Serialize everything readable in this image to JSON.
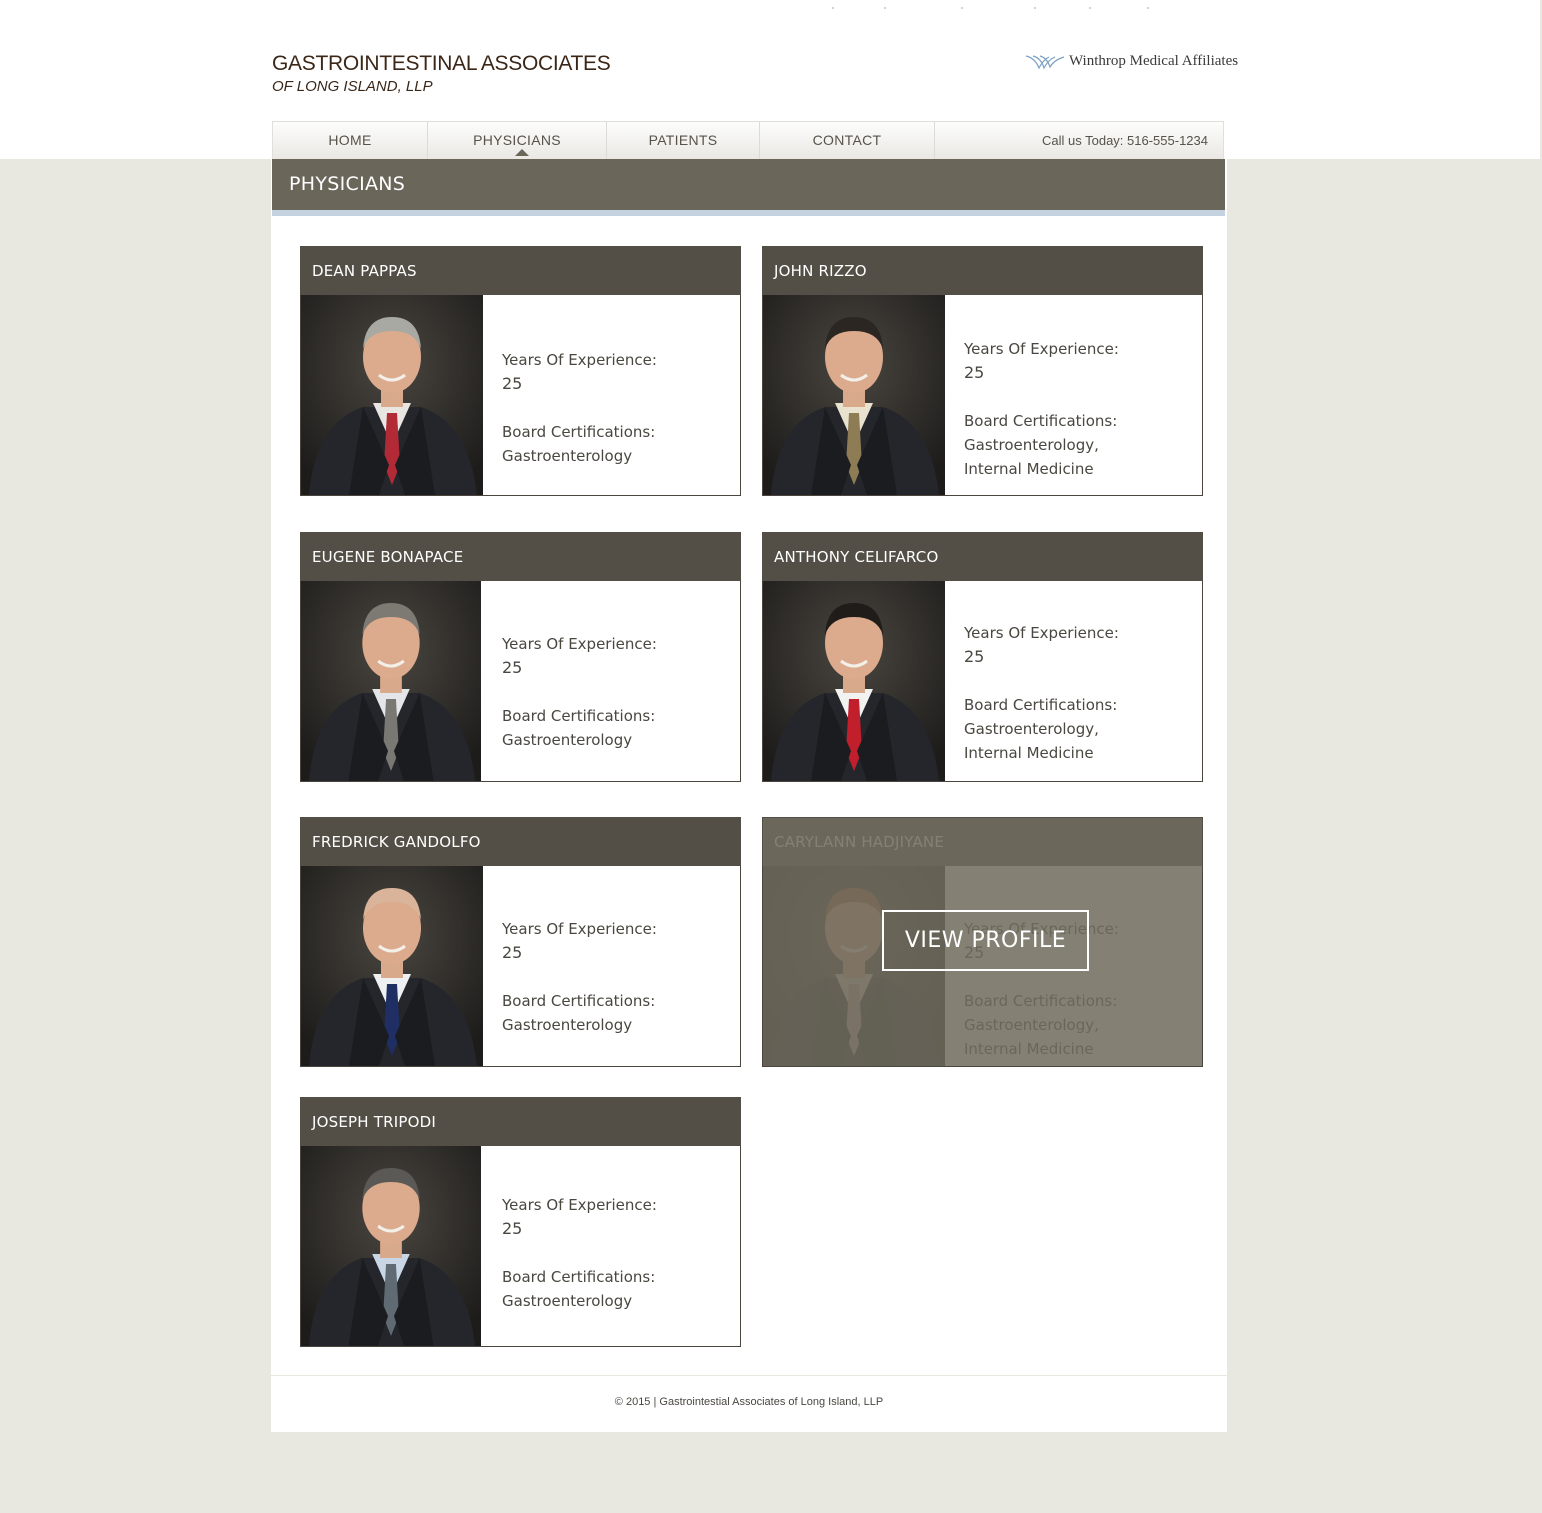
{
  "header": {
    "logo_line1": "GASTROINTESTINAL ASSOCIATES",
    "logo_line2": "OF LONG ISLAND, LLP",
    "affiliate": "Winthrop Medical Affiliates"
  },
  "nav": {
    "items": [
      {
        "label": "HOME"
      },
      {
        "label": "PHYSICIANS",
        "active": true
      },
      {
        "label": "PATIENTS"
      },
      {
        "label": "CONTACT"
      }
    ],
    "phone": "Call us Today: 516-555-1234"
  },
  "page": {
    "title": "PHYSICIANS"
  },
  "labels": {
    "experience": "Years Of Experience:",
    "certifications": "Board Certifications:",
    "view_profile": "VIEW PROFILE"
  },
  "physicians": [
    {
      "name": "DEAN PAPPAS",
      "years": "25",
      "certifications": [
        "Gastroenterology"
      ],
      "tie": "#b22a36",
      "hair": "#a9a9a4",
      "shirt": "#e9e6e1"
    },
    {
      "name": "JOHN RIZZO",
      "years": "25",
      "certifications": [
        "Gastroenterology,",
        "Internal Medicine"
      ],
      "tie": "#8e7c55",
      "hair": "#2b2622",
      "shirt": "#e8e2cf"
    },
    {
      "name": "EUGENE BONAPACE",
      "years": "25",
      "certifications": [
        "Gastroenterology"
      ],
      "tie": "#7a7873",
      "hair": "#7d7a74",
      "shirt": "#e3e5e8"
    },
    {
      "name": "ANTHONY CELIFARCO",
      "years": "25",
      "certifications": [
        "Gastroenterology,",
        "Internal Medicine"
      ],
      "tie": "#c01f2b",
      "hair": "#1f1c1a",
      "shirt": "#f2f2f0"
    },
    {
      "name": "FREDRICK GANDOLFO",
      "years": "25",
      "certifications": [
        "Gastroenterology"
      ],
      "tie": "#1f2f63",
      "hair": "#d9b49b",
      "shirt": "#eef0f2"
    },
    {
      "name": "CARYLANN HADJIYANE",
      "years": "25",
      "certifications": [
        "Gastroenterology,",
        "Internal Medicine"
      ],
      "tie": "#b9a392",
      "hair": "#9a5a32",
      "shirt": "#d5c7b7",
      "hovered": true
    },
    {
      "name": "JOSEPH TRIPODI",
      "years": "25",
      "certifications": [
        "Gastroenterology"
      ],
      "tie": "#5f6a72",
      "hair": "#5a5955",
      "shirt": "#c9d6e6"
    }
  ],
  "footer": {
    "text": "© 2015 | Gastrointestial Associates of Long Island, LLP"
  }
}
